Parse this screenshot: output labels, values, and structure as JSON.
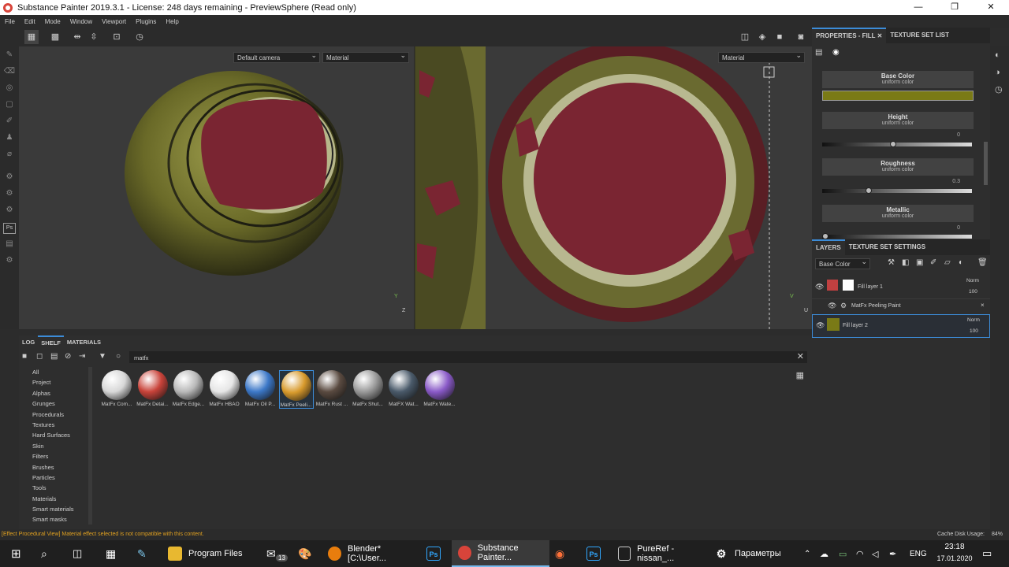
{
  "window": {
    "title": "Substance Painter 2019.3.1 - License: 248 days remaining - PreviewSphere (Read only)",
    "minimize": "—",
    "maximize": "❐",
    "close": "✕"
  },
  "menu": [
    "File",
    "Edit",
    "Mode",
    "Window",
    "Viewport",
    "Plugins",
    "Help"
  ],
  "viewport": {
    "camera_select": "Default camera",
    "material_select_left": "Material",
    "material_select_right": "Material",
    "axis_y": "Y",
    "axis_z": "Z",
    "axis_u": "U",
    "axis_v": "V"
  },
  "properties": {
    "tab_active": "PROPERTIES - FILL",
    "tab_close": "✕",
    "tab_other": "TEXTURE SET LIST",
    "base_color": {
      "title": "Base Color",
      "sub": "uniform color",
      "swatch": "#7a7a16"
    },
    "height": {
      "title": "Height",
      "sub": "uniform color",
      "value": "0",
      "level": 0.47
    },
    "roughness": {
      "title": "Roughness",
      "sub": "uniform color",
      "value": "0.3",
      "level": 0.3
    },
    "metallic": {
      "title": "Metallic",
      "sub": "uniform color",
      "value": "0",
      "level": 0.0
    }
  },
  "layers": {
    "tab_active": "LAYERS",
    "tab_other": "TEXTURE SET SETTINGS",
    "channel": "Base Color",
    "items": [
      {
        "name": "Fill layer 1",
        "blend": "Norm",
        "opacity": "100"
      },
      {
        "name": "MatFx Peeling Paint",
        "close": "×"
      },
      {
        "name": "Fill layer 2",
        "blend": "Norm",
        "opacity": "100"
      }
    ]
  },
  "shelf": {
    "tabs": [
      "LOG",
      "SHELF",
      "MATERIALS"
    ],
    "active_tab": "SHELF",
    "search": "matfx",
    "categories": [
      "All",
      "Project",
      "Alphas",
      "Grunges",
      "Procedurals",
      "Textures",
      "Hard Surfaces",
      "Skin",
      "Filters",
      "Brushes",
      "Particles",
      "Tools",
      "Materials",
      "Smart materials",
      "Smart masks"
    ],
    "materials": [
      {
        "label": "MatFx Com...",
        "color": "#d8d8d8"
      },
      {
        "label": "MatFx Detai...",
        "color": "#c9433a"
      },
      {
        "label": "MatFx Edge...",
        "color": "#b9b9b9"
      },
      {
        "label": "MatFx HBAO",
        "color": "#e6e6e6"
      },
      {
        "label": "MatFx Oil P...",
        "color": "#3c78c8"
      },
      {
        "label": "MatFx Peeli...",
        "color": "#d89a2c"
      },
      {
        "label": "MatFx Rust ...",
        "color": "#5a4a40"
      },
      {
        "label": "MatFx Shut...",
        "color": "#9a9a9a"
      },
      {
        "label": "MatFX Wat...",
        "color": "#4a5a6a"
      },
      {
        "label": "MatFx Wate...",
        "color": "#8a5ac8"
      }
    ]
  },
  "status": {
    "message": "[Effect Procedural View] Material effect selected is not compatible with this content.",
    "disk": "Cache Disk Usage:",
    "disk_value": "84%"
  },
  "taskbar": {
    "items": [
      "Program Files",
      "Blender* [C:\\User...",
      "Substance Painter...",
      "PureRef - nissan_...",
      "Параметры"
    ],
    "mail_badge": "13",
    "lang": "ENG",
    "time": "23:18",
    "date": "17.01.2020",
    "ps_label": "Ps",
    "ps_label2": "Ps"
  }
}
